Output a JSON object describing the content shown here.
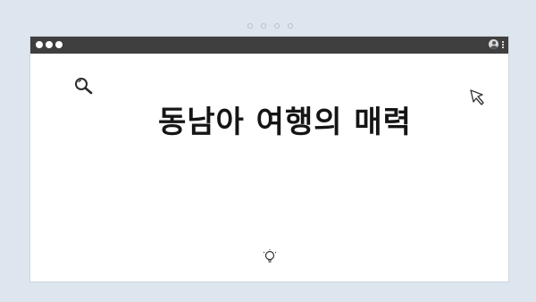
{
  "page": {
    "background_color": "#dde5ee"
  },
  "browser": {
    "titlebar_color": "#3f3f3f",
    "window_dots": 3,
    "top_indicator_dots": 4,
    "icons": [
      "user-icon",
      "kebab-menu-icon"
    ]
  },
  "canvas": {
    "title": "동남아 여행의 매력",
    "icons": [
      "search-icon",
      "cursor-icon",
      "lightbulb-icon"
    ]
  }
}
